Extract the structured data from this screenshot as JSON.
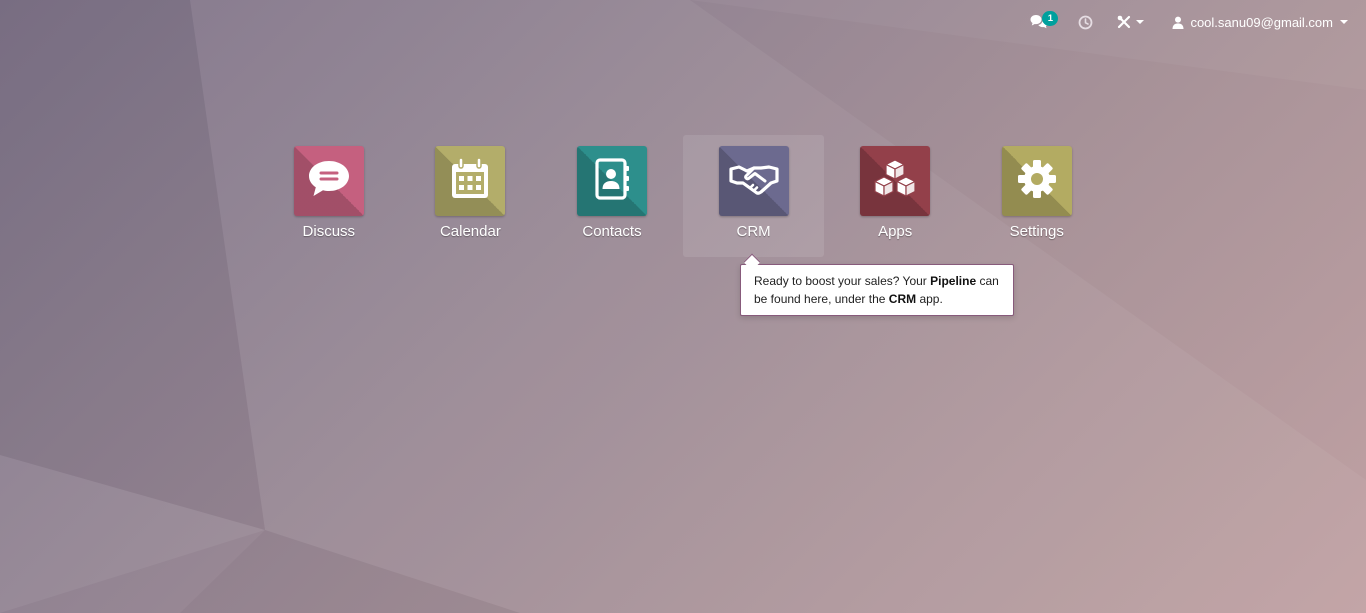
{
  "topbar": {
    "messages_badge": "1",
    "user_email": "cool.sanu09@gmail.com",
    "icons": [
      "chat-icon",
      "clock-icon",
      "tools-icon",
      "user-icon"
    ]
  },
  "apps": [
    {
      "label": "Discuss",
      "icon": "chat-bubble-icon",
      "color": "#c5607f"
    },
    {
      "label": "Calendar",
      "icon": "calendar-icon",
      "color": "#b3ad6a"
    },
    {
      "label": "Contacts",
      "icon": "address-book-icon",
      "color": "#2d8f8c"
    },
    {
      "label": "CRM",
      "icon": "handshake-icon",
      "color": "#6c6a8f"
    },
    {
      "label": "Apps",
      "icon": "cubes-icon",
      "color": "#93404a"
    },
    {
      "label": "Settings",
      "icon": "gear-icon",
      "color": "#b3ab62"
    }
  ],
  "tooltip": {
    "text_1": "Ready to boost your sales? Your ",
    "bold_1": "Pipeline",
    "text_2": " can be found here, under the ",
    "bold_2": "CRM",
    "text_3": " app."
  }
}
